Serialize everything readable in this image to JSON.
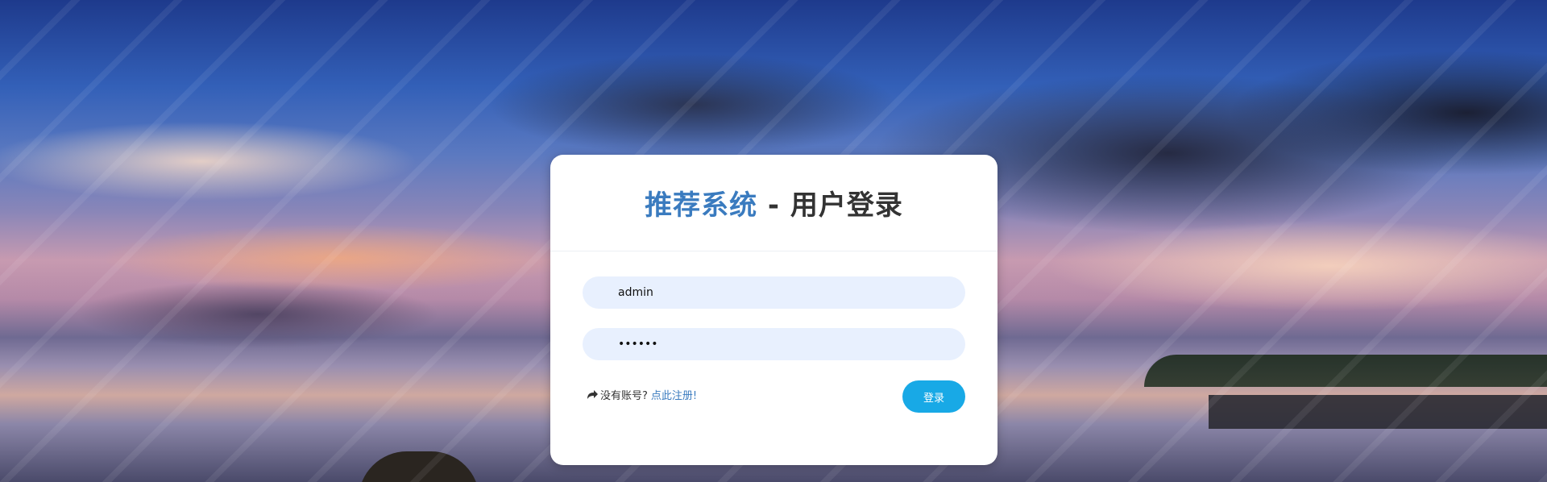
{
  "login": {
    "title_accent": "推荐系统",
    "title_rest": " - 用户登录",
    "username": {
      "value": "admin",
      "placeholder": ""
    },
    "password": {
      "value": "123456",
      "placeholder": ""
    },
    "register_prompt": "没有账号?",
    "register_link": "点此注册!",
    "login_button": "登录"
  },
  "icons": {
    "register": "share-icon"
  },
  "colors": {
    "accent": "#3a7bbf",
    "button": "#18a9e6",
    "input_bg": "#e8f0fe"
  }
}
